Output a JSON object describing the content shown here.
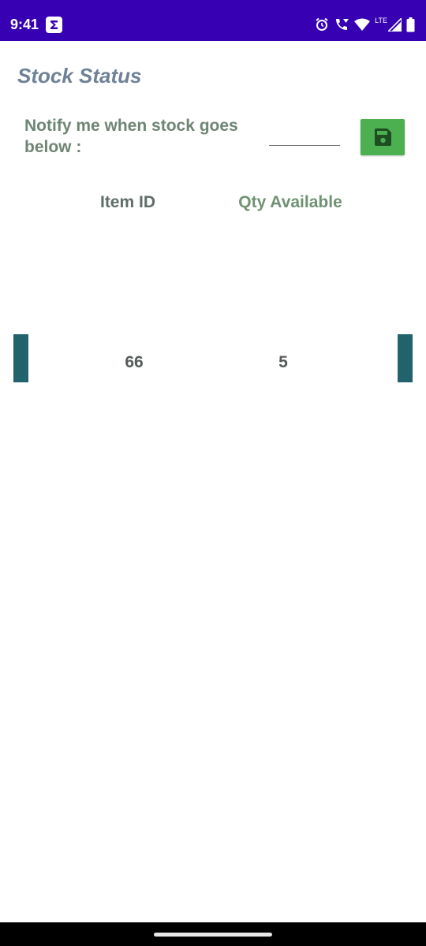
{
  "status_bar": {
    "time": "9:41",
    "network_label": "LTE",
    "background": "#3700b3",
    "icons": [
      "sigma-app-icon",
      "alarm-icon",
      "wifi-call-icon",
      "wifi-icon",
      "signal-icon",
      "battery-icon"
    ]
  },
  "page": {
    "title": "Stock Status"
  },
  "notify": {
    "label": "Notify me when stock goes below :",
    "input_value": "",
    "save_icon": "floppy-save-icon",
    "save_color": "#4caf50"
  },
  "table": {
    "headers": {
      "item_id": "Item ID",
      "qty": "Qty Available"
    },
    "rows": [
      {
        "item_id": "66",
        "qty": "5"
      }
    ]
  }
}
